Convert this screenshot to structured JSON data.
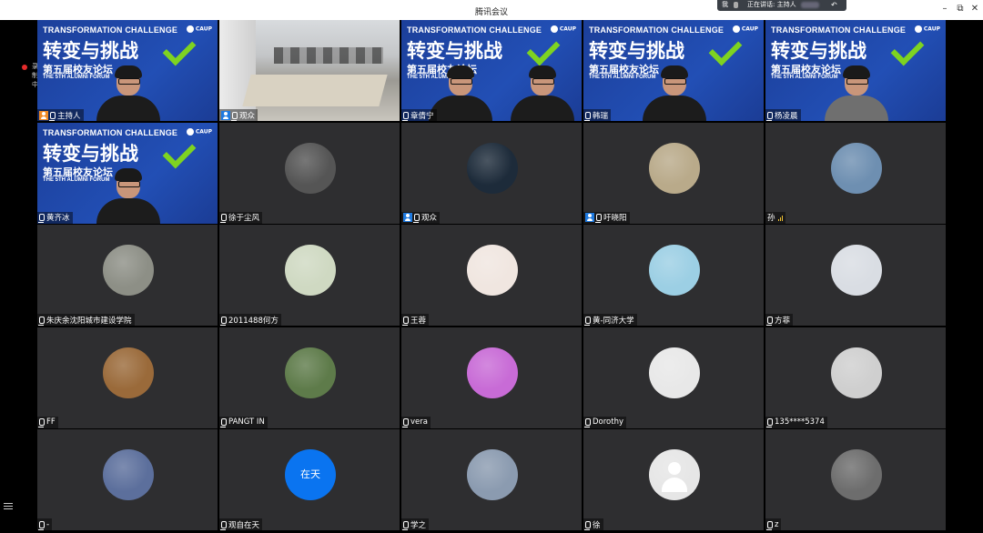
{
  "window": {
    "title": "腾讯会议",
    "speaking_me": "我",
    "speaking_label": "正在讲话: 主持人",
    "back_icon": "undo-icon"
  },
  "recording_label": "录制中",
  "branding": {
    "line1": "TRANSFORMATION CHALLENGE",
    "line2": "转变与挑战",
    "line3": "第五届校友论坛",
    "line4": "THE 5TH ALUMNI FORUM",
    "logo": "CAUP"
  },
  "tiles": [
    {
      "name": "主持人",
      "kind": "video",
      "badge": "host",
      "mic": true
    },
    {
      "name": "观众",
      "kind": "room",
      "badge": "user",
      "mic": true
    },
    {
      "name": "章倩宁",
      "kind": "video",
      "badge": "",
      "mic": true
    },
    {
      "name": "韩瑞",
      "kind": "video",
      "badge": "",
      "mic": true
    },
    {
      "name": "杨凌晨",
      "kind": "video",
      "badge": "",
      "mic": true
    },
    {
      "name": "黄齐冰",
      "kind": "video",
      "badge": "",
      "mic": true
    },
    {
      "name": "徐于尘风",
      "kind": "avatar",
      "badge": "",
      "mic": true,
      "color": "#555"
    },
    {
      "name": "观众",
      "kind": "avatar",
      "badge": "user",
      "mic": true,
      "color": "#1d2b3a"
    },
    {
      "name": "吁晓阳",
      "kind": "avatar",
      "badge": "user",
      "mic": true,
      "color": "#b9aa8a"
    },
    {
      "name": "孙",
      "kind": "avatar",
      "badge": "",
      "mic": false,
      "signal": true,
      "color": "#6e8fb1"
    },
    {
      "name": "朱庆余沈阳城市建设学院",
      "kind": "avatar",
      "badge": "",
      "mic": true,
      "color": "#8d8f86"
    },
    {
      "name": "2011488何方",
      "kind": "avatar",
      "badge": "",
      "mic": true,
      "color": "#cfd9c2"
    },
    {
      "name": "王蓉",
      "kind": "avatar",
      "badge": "",
      "mic": true,
      "color": "#f0e6e0"
    },
    {
      "name": "黄-同济大学",
      "kind": "avatar",
      "badge": "",
      "mic": true,
      "color": "#9ccfe4"
    },
    {
      "name": "方菲",
      "kind": "avatar",
      "badge": "",
      "mic": true,
      "color": "#d9dde3"
    },
    {
      "name": "FF",
      "kind": "avatar",
      "badge": "",
      "mic": true,
      "color": "#9a6a3a"
    },
    {
      "name": "PANGT IN",
      "kind": "avatar",
      "badge": "",
      "mic": true,
      "color": "#5e7b4a"
    },
    {
      "name": "vera",
      "kind": "avatar",
      "badge": "",
      "mic": true,
      "color": "#c86bd6"
    },
    {
      "name": "Dorothy",
      "kind": "avatar",
      "badge": "",
      "mic": true,
      "color": "#e8e8e8"
    },
    {
      "name": "135****5374",
      "kind": "avatar",
      "badge": "",
      "mic": true,
      "color": "#cfcfcf"
    },
    {
      "name": "-",
      "kind": "avatar",
      "badge": "",
      "mic": true,
      "color": "#5c6f9c"
    },
    {
      "name": "观自在天",
      "kind": "text-avatar",
      "badge": "",
      "mic": true,
      "avatar_text": "在天"
    },
    {
      "name": "学之",
      "kind": "avatar",
      "badge": "",
      "mic": true,
      "color": "#8b9bb0"
    },
    {
      "name": "徐",
      "kind": "avatar",
      "badge": "",
      "mic": true,
      "color": "#e6e6e6"
    },
    {
      "name": "z",
      "kind": "avatar",
      "badge": "",
      "mic": true,
      "color": "#6d6d6d"
    }
  ]
}
